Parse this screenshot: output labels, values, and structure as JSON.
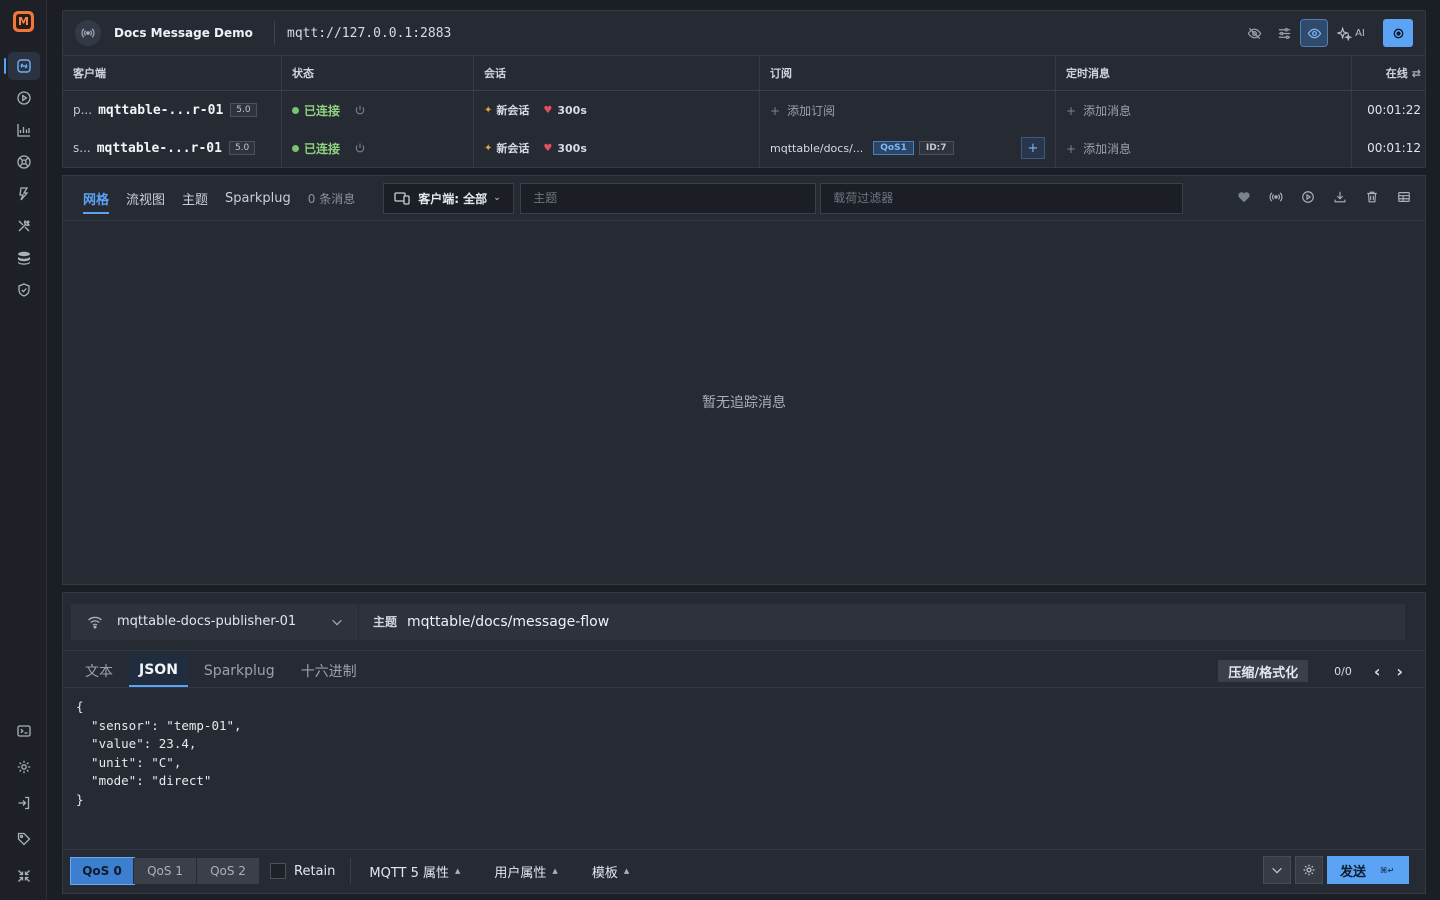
{
  "app": {
    "logo_letter": "M",
    "accent": "#5ba3f5"
  },
  "sidebar": {
    "top_items": [
      {
        "icon": "connections-icon",
        "active": true
      },
      {
        "icon": "play-circle-icon"
      },
      {
        "icon": "chart-icon"
      },
      {
        "icon": "broker-icon"
      },
      {
        "icon": "script-icon"
      },
      {
        "icon": "tools-icon"
      },
      {
        "icon": "database-icon"
      },
      {
        "icon": "shield-icon"
      }
    ],
    "bottom_items": [
      {
        "icon": "terminal-icon"
      },
      {
        "icon": "settings-icon"
      },
      {
        "icon": "login-icon"
      },
      {
        "icon": "tag-icon"
      },
      {
        "icon": "collapse-icon"
      }
    ]
  },
  "connection": {
    "name": "Docs Message Demo",
    "url": "mqtt://127.0.0.1:2883",
    "ai_label": "AI"
  },
  "client_table": {
    "headers": {
      "client": "客户端",
      "status": "状态",
      "session": "会话",
      "subscriptions": "订阅",
      "scheduled": "定时消息",
      "online": "在线"
    },
    "rows": [
      {
        "prefix": "p...",
        "name": "mqttable-...r-01",
        "version": "5.0",
        "status": "已连接",
        "session": "新会话",
        "expiry": "300s",
        "subscription": {
          "empty_label": "添加订阅"
        },
        "scheduled_label": "添加消息",
        "online_time": "00:01:22"
      },
      {
        "prefix": "s...",
        "name": "mqttable-...r-01",
        "version": "5.0",
        "status": "已连接",
        "session": "新会话",
        "expiry": "300s",
        "subscription": {
          "topic": "mqttable/docs/...",
          "qos": "QoS1",
          "id": "ID:7"
        },
        "scheduled_label": "添加消息",
        "online_time": "00:01:12"
      }
    ]
  },
  "messages": {
    "tabs": [
      "网格",
      "流视图",
      "主题",
      "Sparkplug"
    ],
    "active_tab": 0,
    "count": "0 条消息",
    "client_filter": "客户端: 全部",
    "topic_placeholder": "主题",
    "payload_placeholder": "载荷过滤器",
    "empty": "暂无追踪消息"
  },
  "publish": {
    "client": "mqttable-docs-publisher-01",
    "topic_label": "主题",
    "topic": "mqttable/docs/message-flow",
    "payload_tabs": [
      "文本",
      "JSON",
      "Sparkplug",
      "十六进制"
    ],
    "active_payload_tab": 1,
    "format_button": "压缩/格式化",
    "pager": "0/0",
    "payload": "{\n  \"sensor\": \"temp-01\",\n  \"value\": 23.4,\n  \"unit\": \"C\",\n  \"mode\": \"direct\"\n}",
    "qos_options": [
      "QoS 0",
      "QoS 1",
      "QoS 2"
    ],
    "active_qos": 0,
    "retain_label": "Retain",
    "mqtt5_props": "MQTT 5 属性",
    "user_props": "用户属性",
    "template": "模板",
    "send": "发送",
    "send_shortcut": "⌘↵"
  }
}
